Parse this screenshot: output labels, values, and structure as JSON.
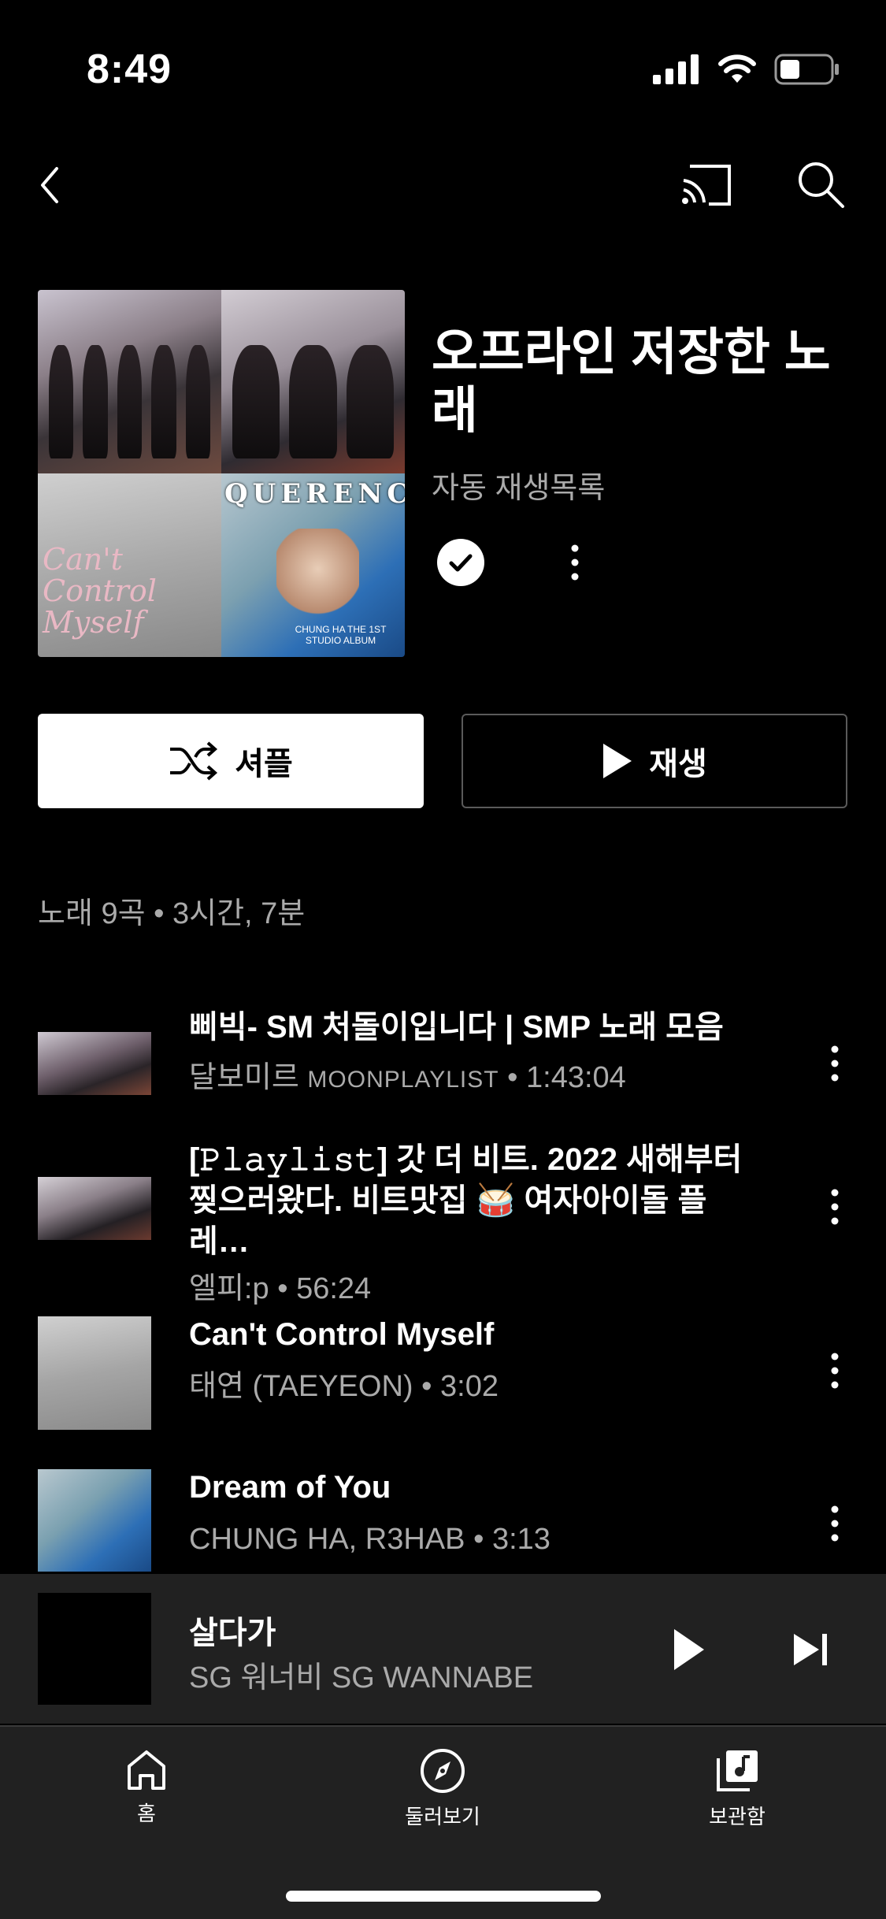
{
  "status_bar": {
    "time": "8:49",
    "signal_icon": "cellular-signal-icon",
    "wifi_icon": "wifi-icon",
    "battery_icon": "battery-icon"
  },
  "top_nav": {
    "back_icon": "chevron-left-icon",
    "cast_icon": "cast-icon",
    "search_icon": "search-icon"
  },
  "header": {
    "title": "오프라인 저장한 노래",
    "type": "자동 재생목록",
    "saved_icon": "check-circle-icon",
    "more_icon": "more-vertical-icon",
    "art_labels": {
      "tile3": "Can't Control Myself",
      "tile4_title": "QUERENCIA",
      "tile4_sub": "CHUNG HA THE 1ST STUDIO ALBUM"
    }
  },
  "actions": {
    "shuffle_label": "셔플",
    "play_label": "재생",
    "shuffle_icon": "shuffle-icon",
    "play_icon": "play-icon"
  },
  "summary": "노래 9곡 • 3시간, 7분",
  "tracks": [
    {
      "title": "삐빅- SM 처돌이입니다 | SMP 노래 모음",
      "artist": "달보미르",
      "artist_extra": "MOONPLAYLIST",
      "duration": "1:43:04"
    },
    {
      "title": "[𝙿𝚕𝚊𝚢𝚕𝚒𝚜𝚝] 갓 더 비트. 2022 새해부터 찢으러왔다. 비트맛집 🥁 여자아이돌 플레…",
      "artist": "엘피:p",
      "artist_extra": "",
      "duration": "56:24"
    },
    {
      "title": "Can't Control Myself",
      "artist": "태연 (TAEYEON)",
      "artist_extra": "",
      "duration": "3:02"
    },
    {
      "title": "Dream of You",
      "artist": "CHUNG HA, R3HAB",
      "artist_extra": "",
      "duration": "3:13"
    }
  ],
  "separator": "•",
  "mini_player": {
    "title": "살다가",
    "artist": "SG 워너비 SG WANNABE",
    "play_icon": "play-icon",
    "next_icon": "skip-next-icon"
  },
  "bottom_nav": [
    {
      "label": "홈",
      "icon": "home-icon"
    },
    {
      "label": "둘러보기",
      "icon": "compass-icon"
    },
    {
      "label": "보관함",
      "icon": "library-icon"
    }
  ]
}
